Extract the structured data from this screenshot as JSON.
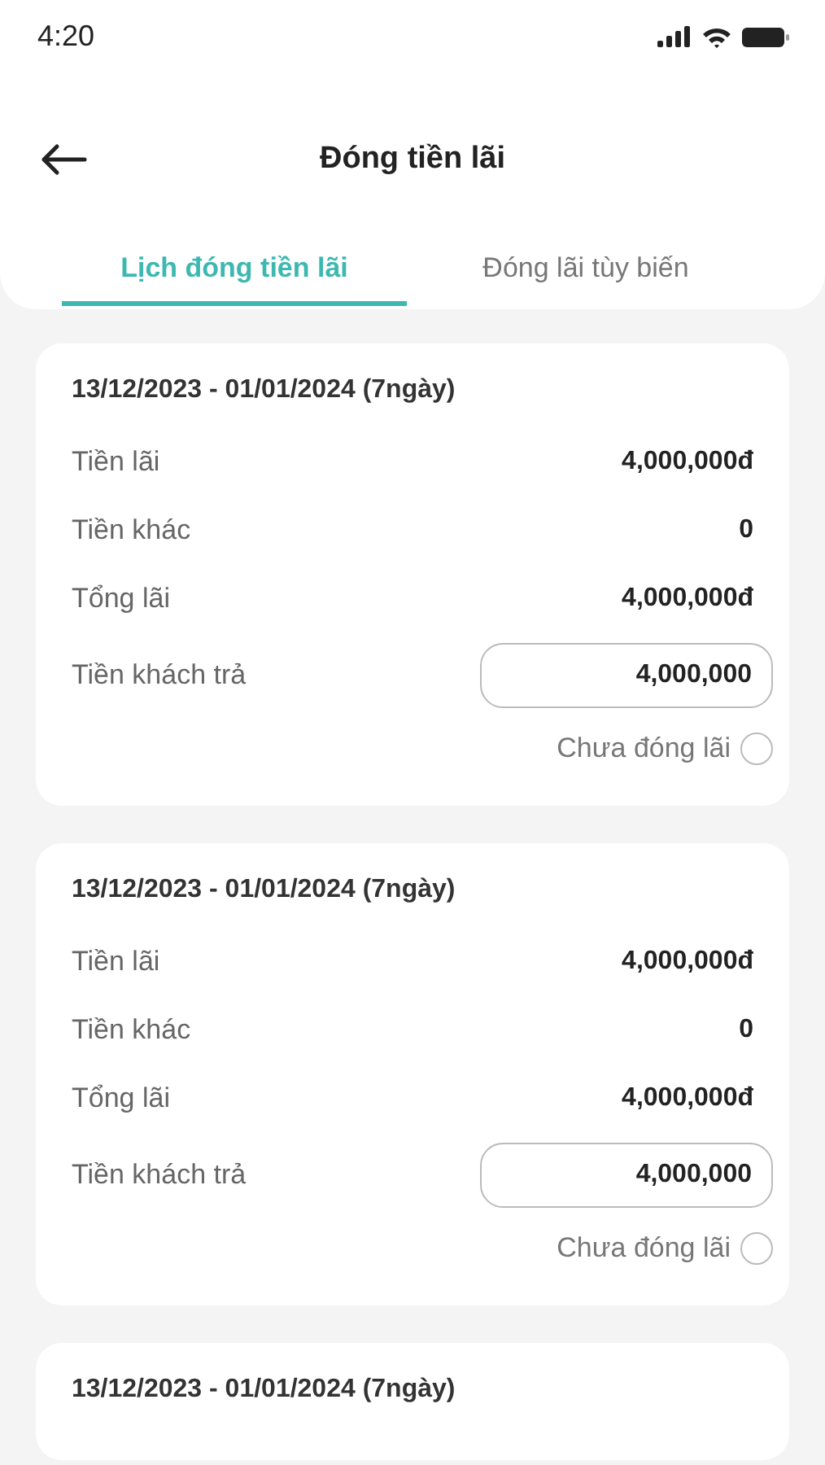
{
  "status_bar": {
    "time": "4:20"
  },
  "header": {
    "title": "Đóng tiền lãi"
  },
  "tabs": [
    {
      "label": "Lịch đóng tiền lãi",
      "selected": true
    },
    {
      "label": "Đóng lãi tùy biến",
      "selected": false
    }
  ],
  "periods": [
    {
      "title": "13/12/2023 - 01/01/2024 (7ngày)",
      "rows": [
        {
          "kind": "amount",
          "label": "Tiền lãi",
          "value": "4,000,000đ"
        },
        {
          "kind": "amount",
          "label": "Tiền khác",
          "value": "0"
        },
        {
          "kind": "amount",
          "label": "Tổng lãi",
          "value": "4,000,000đ"
        },
        {
          "kind": "input",
          "label": "Tiền khách trả",
          "value": "4,000,000"
        }
      ],
      "paid": {
        "label": "Chưa đóng lãi",
        "checked": false
      }
    },
    {
      "title": "13/12/2023 - 01/01/2024 (7ngày)",
      "rows": [
        {
          "kind": "amount",
          "label": "Tiền lãi",
          "value": "4,000,000đ"
        },
        {
          "kind": "amount",
          "label": "Tiền khác",
          "value": "0"
        },
        {
          "kind": "amount",
          "label": "Tổng lãi",
          "value": "4,000,000đ"
        },
        {
          "kind": "input",
          "label": "Tiền khách trả",
          "value": "4,000,000"
        }
      ],
      "paid": {
        "label": "Chưa đóng lãi",
        "checked": false
      }
    },
    {
      "title": "13/12/2023 - 01/01/2024 (7ngày)"
    }
  ]
}
